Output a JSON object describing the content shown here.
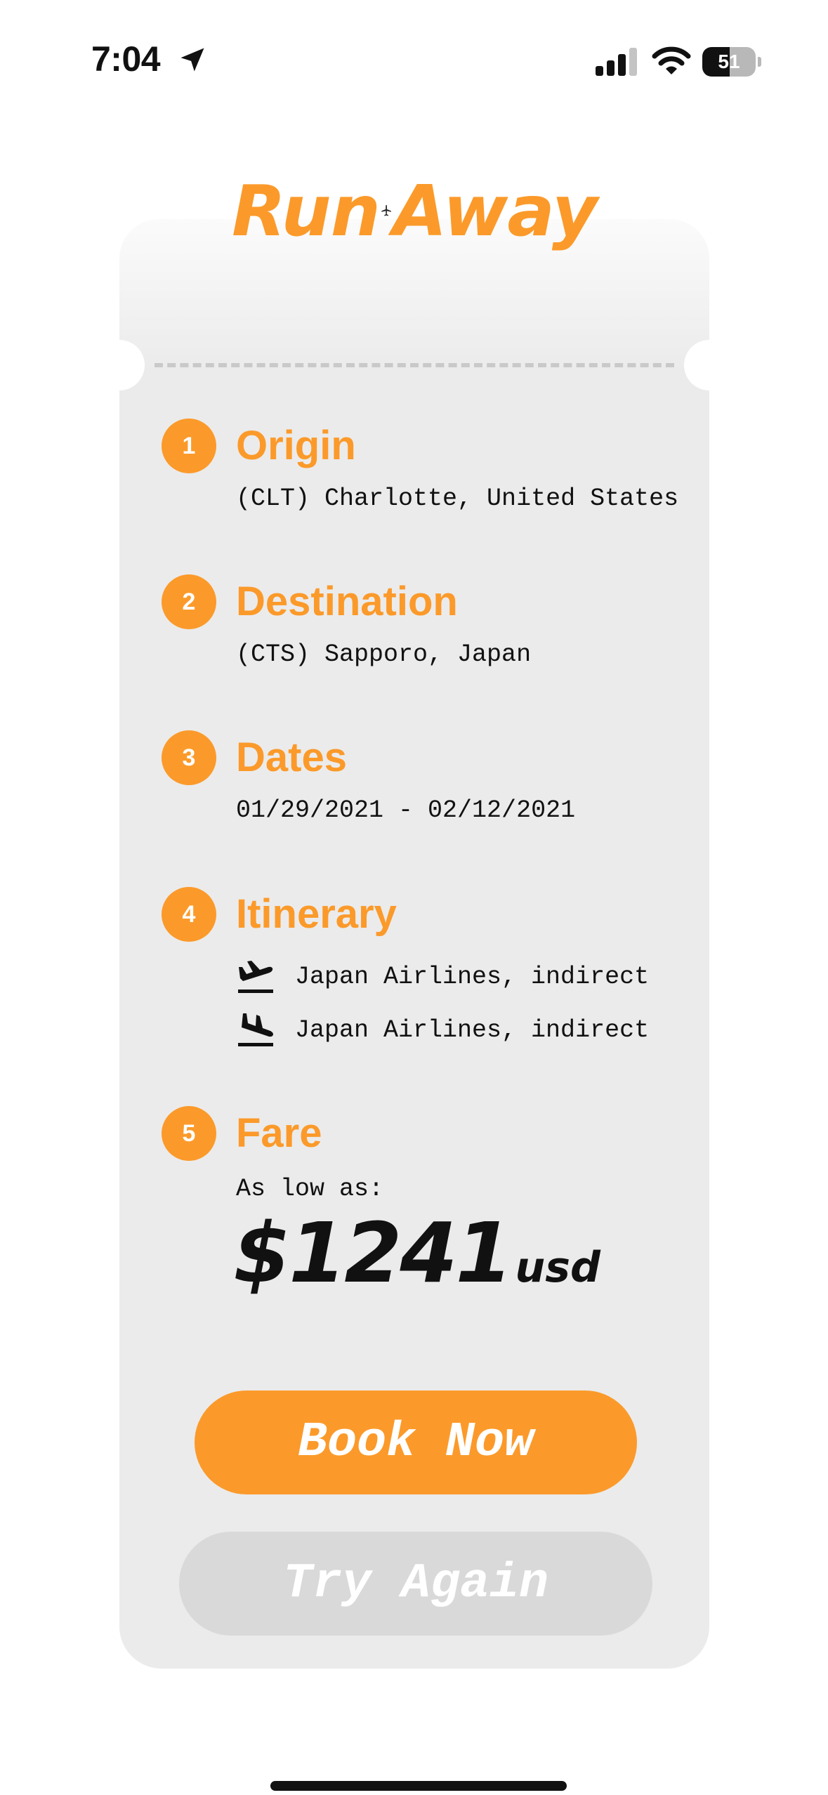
{
  "status_bar": {
    "time": "7:04",
    "battery": "51",
    "battery_level": 0.51,
    "icons": [
      "location-arrow-icon",
      "signal-bars-icon",
      "wifi-icon",
      "battery-icon"
    ]
  },
  "app": {
    "logo_left": "Run",
    "logo_right": "Away",
    "logo_icon": "airplane-icon",
    "brand_color": "#fb9a2a"
  },
  "sections": {
    "origin": {
      "number": "1",
      "title": "Origin",
      "value": "(CLT) Charlotte, United States"
    },
    "destination": {
      "number": "2",
      "title": "Destination",
      "value": "(CTS) Sapporo, Japan"
    },
    "dates": {
      "number": "3",
      "title": "Dates",
      "value": "01/29/2021 - 02/12/2021"
    },
    "itinerary": {
      "number": "4",
      "title": "Itinerary",
      "legs": [
        {
          "icon": "departure-icon",
          "text": "Japan Airlines, indirect"
        },
        {
          "icon": "arrival-icon",
          "text": "Japan Airlines, indirect"
        }
      ]
    },
    "fare": {
      "number": "5",
      "title": "Fare",
      "label": "As low as:",
      "amount": "$1241",
      "currency": "usd"
    }
  },
  "buttons": {
    "book": "Book Now",
    "try_again": "Try Again"
  }
}
